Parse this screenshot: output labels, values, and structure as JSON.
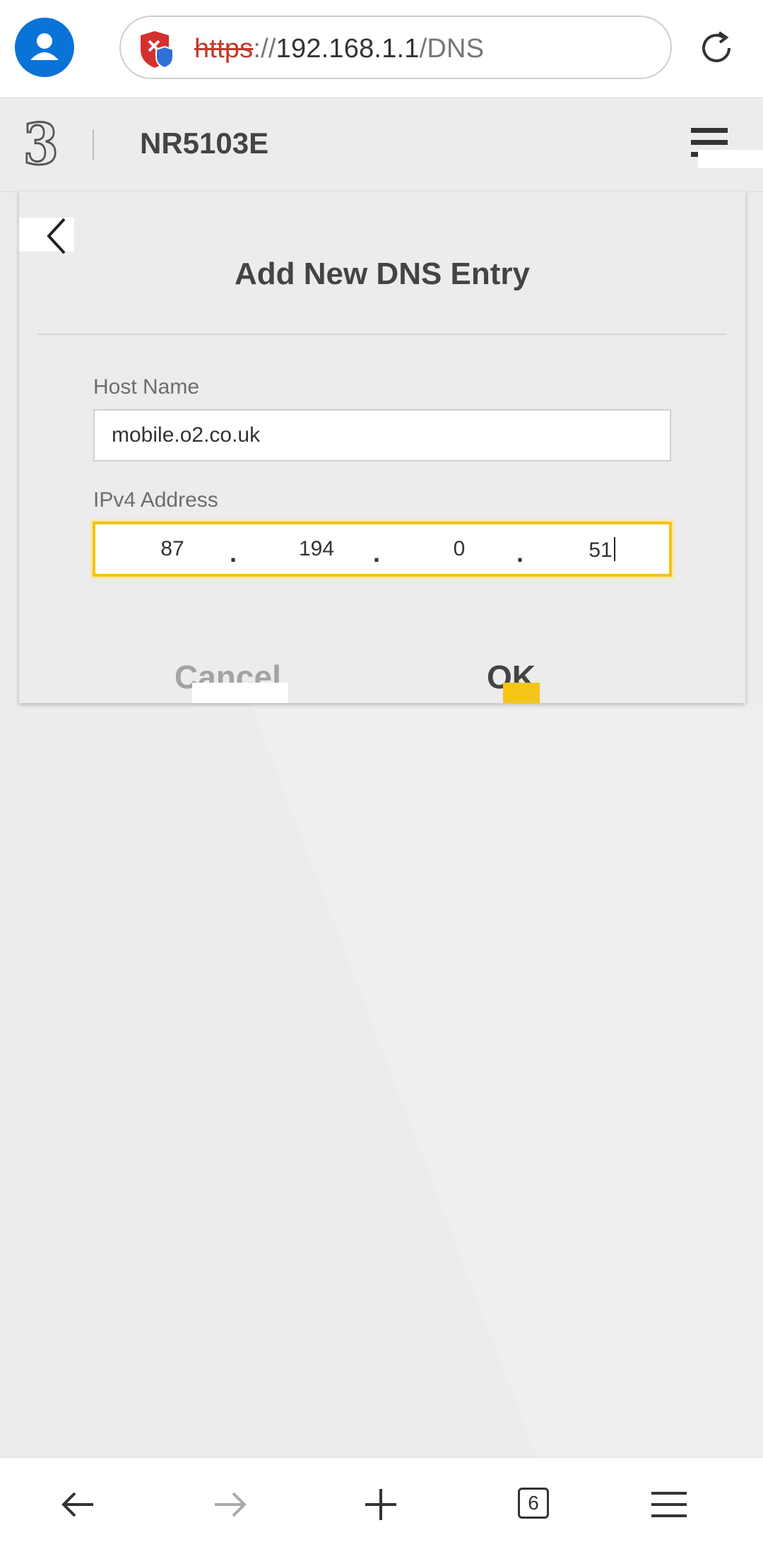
{
  "browser": {
    "url_scheme": "https",
    "url_separator": "://",
    "url_host": "192.168.1.1",
    "url_path": "/DNS",
    "tab_count": "6"
  },
  "header": {
    "logo": "3",
    "device_name": "NR5103E"
  },
  "dialog": {
    "title": "Add New DNS Entry",
    "host_label": "Host Name",
    "host_value": "mobile.o2.co.uk",
    "ip_label": "IPv4 Address",
    "ip_octets": [
      "87",
      "194",
      "0",
      "51"
    ],
    "ip_separator": ".",
    "cancel_label": "Cancel",
    "ok_label": "OK"
  },
  "colors": {
    "profile": "#0a73d8",
    "accent_yellow": "#f2c419",
    "scheme_red": "#c0392b"
  }
}
